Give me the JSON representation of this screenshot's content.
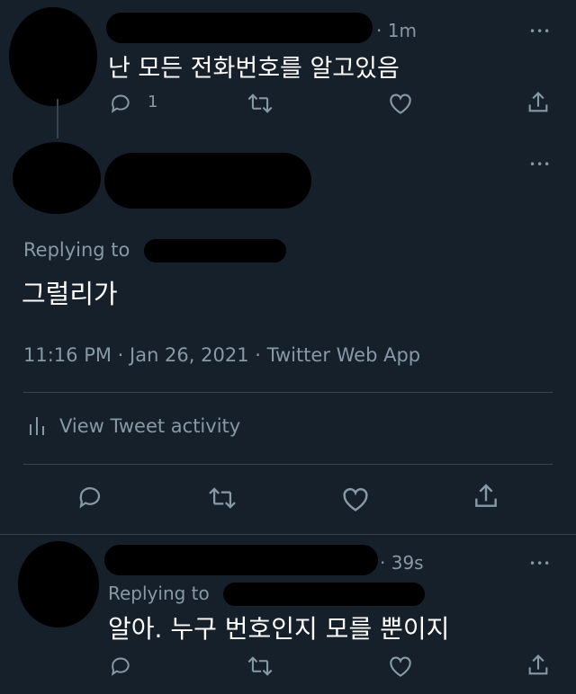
{
  "tweet1": {
    "time": "· 1m",
    "text": "난 모든 전화번호를 알고있음",
    "reply_count": "1"
  },
  "main_tweet": {
    "replying_to_label": "Replying to",
    "text": "그럴리가",
    "timestamp": "11:16 PM · Jan 26, 2021 · Twitter Web App",
    "activity_label": "View Tweet activity"
  },
  "tweet3": {
    "time": "· 39s",
    "replying_to_label": "Replying to",
    "text": "알아. 누구 번호인지 모를 뿐이지"
  },
  "more_glyph": "•••",
  "colors": {
    "background": "#15202b",
    "muted": "#8899a6",
    "divider": "#38444d"
  }
}
